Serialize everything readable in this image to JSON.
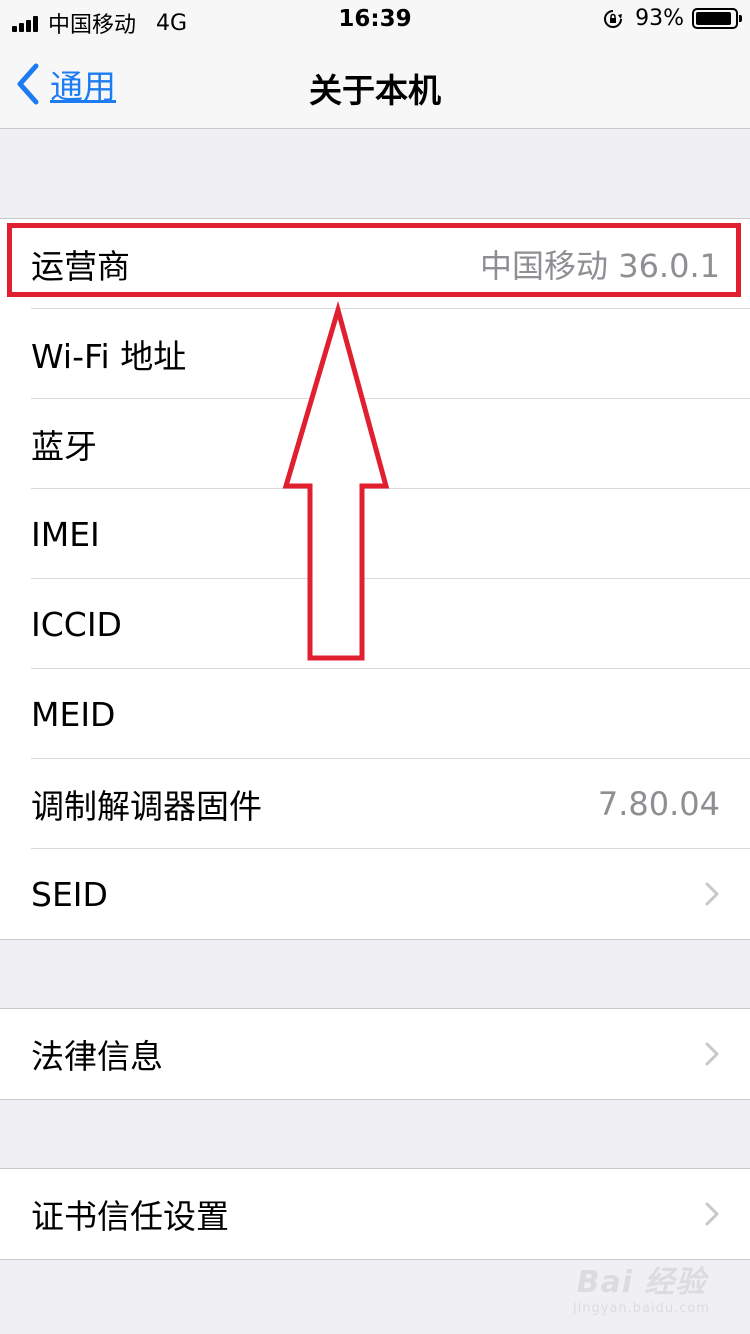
{
  "status_bar": {
    "carrier": "中国移动",
    "network": "4G",
    "time": "16:39",
    "battery_percent": "93%",
    "battery_level": 0.93
  },
  "nav": {
    "back_label": "通用",
    "title": "关于本机"
  },
  "group1": [
    {
      "label": "运营商",
      "value": "中国移动 36.0.1"
    },
    {
      "label": "Wi-Fi 地址",
      "value": ""
    },
    {
      "label": "蓝牙",
      "value": ""
    },
    {
      "label": "IMEI",
      "value": ""
    },
    {
      "label": "ICCID",
      "value": ""
    },
    {
      "label": "MEID",
      "value": ""
    },
    {
      "label": "调制解调器固件",
      "value": "7.80.04"
    },
    {
      "label": "SEID",
      "value": ""
    }
  ],
  "group2": [
    {
      "label": "法律信息"
    }
  ],
  "group3": [
    {
      "label": "证书信任设置"
    }
  ],
  "watermark": {
    "main": "Bai 经验",
    "sub": "jingyan.baidu.com"
  },
  "colors": {
    "accent": "#1d7cf2",
    "annotation": "#e0202e",
    "background": "#efeff4"
  }
}
